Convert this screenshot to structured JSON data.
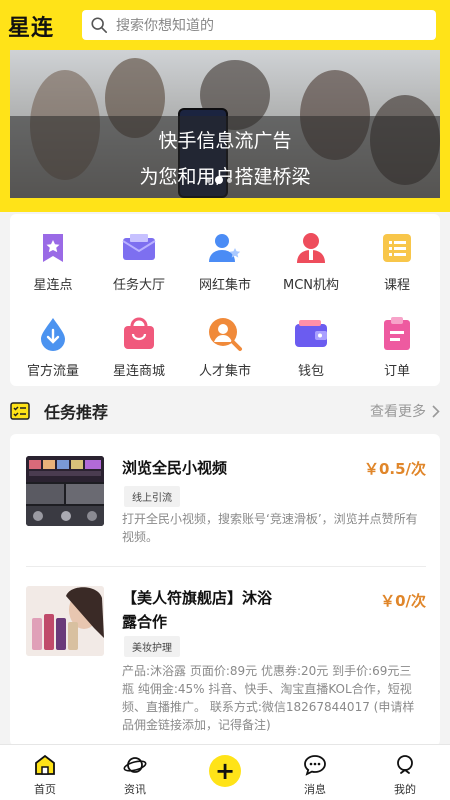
{
  "app": {
    "logo": "星连"
  },
  "search": {
    "placeholder": "搜索你想知道的"
  },
  "banner": {
    "line1": "快手信息流广告",
    "line2": "为您和用户搭建桥梁"
  },
  "categories": [
    {
      "label": "星连点",
      "icon": "star-bookmark-icon",
      "color": "#9a6ae6"
    },
    {
      "label": "任务大厅",
      "icon": "envelope-icon",
      "color": "#7d6ff0"
    },
    {
      "label": "网红集市",
      "icon": "person-star-icon",
      "color": "#4b8cf5"
    },
    {
      "label": "MCN机构",
      "icon": "agency-icon",
      "color": "#ee4d5c"
    },
    {
      "label": "课程",
      "icon": "list-icon",
      "color": "#f8c64a"
    },
    {
      "label": "官方流量",
      "icon": "water-drop-icon",
      "color": "#4b93f0"
    },
    {
      "label": "星连商城",
      "icon": "shopping-bag-icon",
      "color": "#f0597c"
    },
    {
      "label": "人才集市",
      "icon": "talent-search-icon",
      "color": "#f08a3a"
    },
    {
      "label": "钱包",
      "icon": "wallet-icon",
      "color": "#6b5cf0"
    },
    {
      "label": "订单",
      "icon": "clipboard-icon",
      "color": "#ee5aa0"
    }
  ],
  "section": {
    "title": "任务推荐",
    "more": "查看更多"
  },
  "tasks": [
    {
      "title": "浏览全民小视频",
      "price": "￥0.5/次",
      "tag": "线上引流",
      "desc": "打开全民小视频，搜索账号‘竞速滑板’，浏览并点赞所有视频。"
    },
    {
      "title": "【美人符旗舰店】沐浴露合作",
      "title_line1": "【美人符旗舰店】沐浴",
      "title_line2": "露合作",
      "price": "￥0/次",
      "tag": "美妆护理",
      "desc": "产品:沐浴露 页面价:89元 优惠券:20元 到手价:69元三瓶 纯佣金:45% 抖音、快手、淘宝直播KOL合作，短视频、直播推广。 联系方式:微信18267844017 (申请样品佣金链接添加，记得备注)"
    }
  ],
  "tabbar": [
    {
      "label": "首页",
      "icon": "home-icon"
    },
    {
      "label": "资讯",
      "icon": "planet-icon"
    },
    {
      "label": "",
      "icon": "plus-icon"
    },
    {
      "label": "消息",
      "icon": "chat-icon"
    },
    {
      "label": "我的",
      "icon": "user-icon"
    }
  ],
  "colors": {
    "brand": "#ffe318",
    "price": "#e0862a"
  }
}
